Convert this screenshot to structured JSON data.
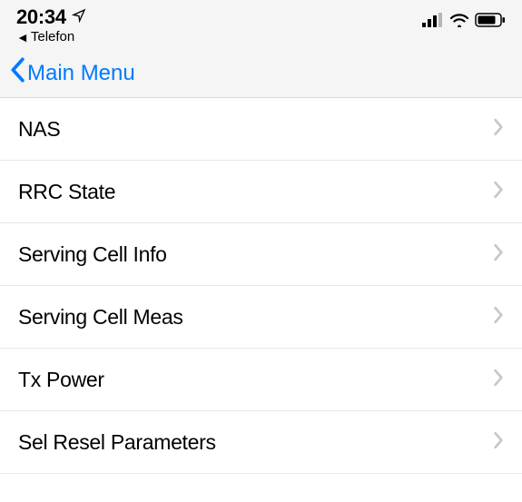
{
  "status_bar": {
    "time": "20:34",
    "back_app": "Telefon"
  },
  "nav": {
    "back_label": "Main Menu"
  },
  "list": {
    "items": [
      {
        "label": "NAS"
      },
      {
        "label": "RRC State"
      },
      {
        "label": "Serving Cell Info"
      },
      {
        "label": "Serving Cell Meas"
      },
      {
        "label": "Tx Power"
      },
      {
        "label": "Sel Resel Parameters"
      }
    ]
  }
}
